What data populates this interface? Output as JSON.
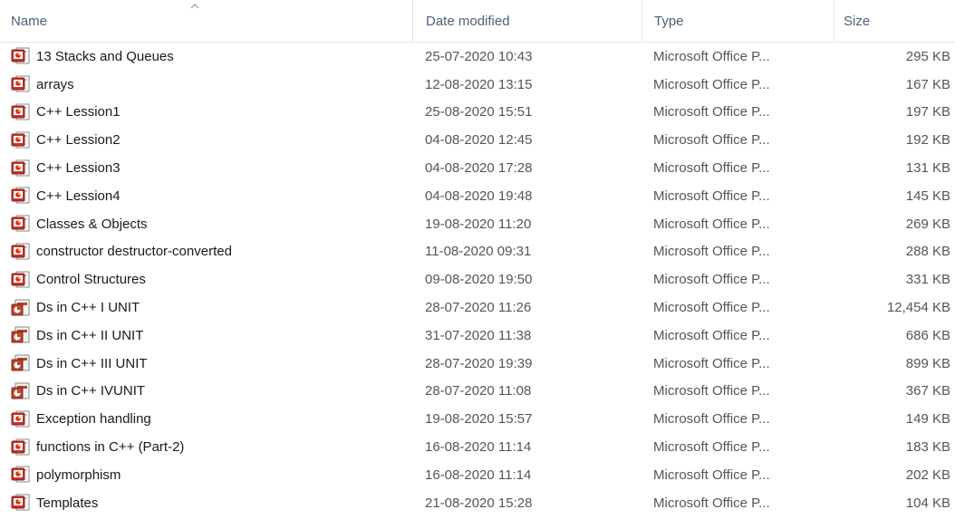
{
  "columns": {
    "name": "Name",
    "date_modified": "Date modified",
    "type": "Type",
    "size": "Size"
  },
  "colors": {
    "header_text": "#4c607a",
    "ppt_red": "#c9312a",
    "ppt_outline": "#8a1d18",
    "pdf_red": "#b7472a"
  },
  "files": [
    {
      "name": "13 Stacks and Queues",
      "date": "25-07-2020 10:43",
      "type": "Microsoft Office P...",
      "size": "295 KB",
      "icon": "ppt-file-icon"
    },
    {
      "name": "arrays",
      "date": "12-08-2020 13:15",
      "type": "Microsoft Office P...",
      "size": "167 KB",
      "icon": "ppt-file-icon"
    },
    {
      "name": "C++ Lession1",
      "date": "25-08-2020 15:51",
      "type": "Microsoft Office P...",
      "size": "197 KB",
      "icon": "ppt-file-icon"
    },
    {
      "name": "C++ Lession2",
      "date": "04-08-2020 12:45",
      "type": "Microsoft Office P...",
      "size": "192 KB",
      "icon": "ppt-file-icon"
    },
    {
      "name": "C++ Lession3",
      "date": "04-08-2020 17:28",
      "type": "Microsoft Office P...",
      "size": "131 KB",
      "icon": "ppt-file-icon"
    },
    {
      "name": "C++ Lession4",
      "date": "04-08-2020 19:48",
      "type": "Microsoft Office P...",
      "size": "145 KB",
      "icon": "ppt-file-icon"
    },
    {
      "name": "Classes & Objects",
      "date": "19-08-2020 11:20",
      "type": "Microsoft Office P...",
      "size": "269 KB",
      "icon": "ppt-file-icon"
    },
    {
      "name": "constructor destructor-converted",
      "date": "11-08-2020 09:31",
      "type": "Microsoft Office P...",
      "size": "288 KB",
      "icon": "ppt-file-icon"
    },
    {
      "name": "Control Structures",
      "date": "09-08-2020 19:50",
      "type": "Microsoft Office P...",
      "size": "331 KB",
      "icon": "ppt-file-icon"
    },
    {
      "name": "Ds in C++ I UNIT",
      "date": "28-07-2020 11:26",
      "type": "Microsoft Office P...",
      "size": "12,454 KB",
      "icon": "pptx-file-icon"
    },
    {
      "name": "Ds in C++ II UNIT",
      "date": "31-07-2020 11:38",
      "type": "Microsoft Office P...",
      "size": "686 KB",
      "icon": "pptx-file-icon"
    },
    {
      "name": "Ds in C++ III UNIT",
      "date": "28-07-2020 19:39",
      "type": "Microsoft Office P...",
      "size": "899 KB",
      "icon": "pptx-file-icon"
    },
    {
      "name": "Ds in C++ IVUNIT",
      "date": "28-07-2020 11:08",
      "type": "Microsoft Office P...",
      "size": "367 KB",
      "icon": "pptx-file-icon"
    },
    {
      "name": "Exception handling",
      "date": "19-08-2020 15:57",
      "type": "Microsoft Office P...",
      "size": "149 KB",
      "icon": "ppt-file-icon"
    },
    {
      "name": "functions in C++ (Part-2)",
      "date": "16-08-2020 11:14",
      "type": "Microsoft Office P...",
      "size": "183 KB",
      "icon": "ppt-file-icon"
    },
    {
      "name": "polymorphism",
      "date": "16-08-2020 11:14",
      "type": "Microsoft Office P...",
      "size": "202 KB",
      "icon": "ppt-file-icon"
    },
    {
      "name": "Templates",
      "date": "21-08-2020 15:28",
      "type": "Microsoft Office P...",
      "size": "104 KB",
      "icon": "ppt-file-icon"
    }
  ]
}
